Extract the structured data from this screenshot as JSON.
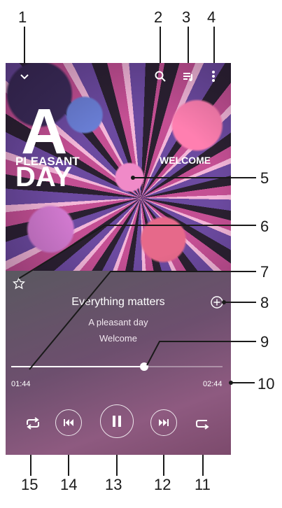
{
  "album_art": {
    "title_big": "A",
    "title_line2": "PLEASANT",
    "title_line3": "DAY",
    "label_right": "WELCOME"
  },
  "toolbar": {
    "collapse_icon": "chevron-down-icon",
    "search_icon": "search-icon",
    "queue_icon": "queue-icon",
    "more_icon": "more-vert-icon"
  },
  "track": {
    "title": "Everything matters",
    "album": "A pleasant day",
    "artist": "Welcome"
  },
  "progress": {
    "elapsed": "01:44",
    "total": "02:44",
    "fraction": 0.63
  },
  "controls": {
    "shuffle_icon": "shuffle-icon",
    "previous_icon": "skip-previous-icon",
    "play_pause_icon": "pause-icon",
    "next_icon": "skip-next-icon",
    "repeat_icon": "repeat-icon"
  },
  "callouts": [
    "1",
    "2",
    "3",
    "4",
    "5",
    "6",
    "7",
    "8",
    "9",
    "10",
    "11",
    "12",
    "13",
    "14",
    "15"
  ],
  "colors": {
    "callout_text": "#1a1a1a",
    "player_bg": "#6d4f6e",
    "accent": "#ffffff"
  }
}
